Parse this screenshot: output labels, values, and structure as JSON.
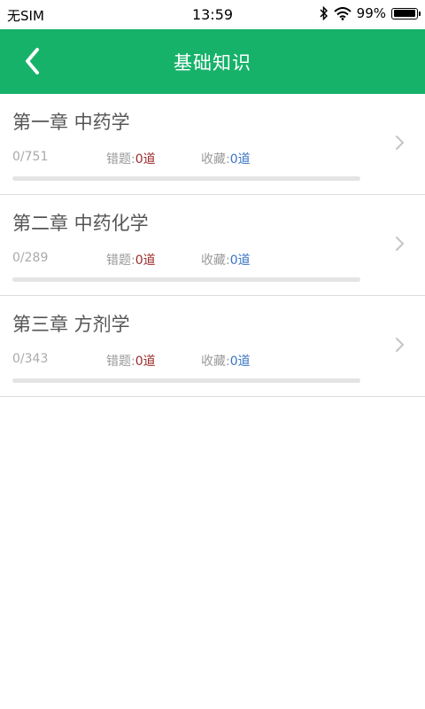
{
  "status": {
    "carrier": "无SIM",
    "time": "13:59",
    "battery": "99%",
    "battery_level": 0.99
  },
  "header": {
    "title": "基础知识"
  },
  "chapters": [
    {
      "title": "第一章 中药学",
      "progress": "0/751",
      "wrong_label": "错题:",
      "wrong_value": "0道",
      "fav_label": "收藏:",
      "fav_value": "0道",
      "progress_fraction": 0
    },
    {
      "title": "第二章 中药化学",
      "progress": "0/289",
      "wrong_label": "错题:",
      "wrong_value": "0道",
      "fav_label": "收藏:",
      "fav_value": "0道",
      "progress_fraction": 0
    },
    {
      "title": "第三章 方剂学",
      "progress": "0/343",
      "wrong_label": "错题:",
      "wrong_value": "0道",
      "fav_label": "收藏:",
      "fav_value": "0道",
      "progress_fraction": 0
    }
  ],
  "colors": {
    "primary": "#17b26a",
    "wrong_value": "#9b2b2b",
    "fav_value": "#3a75c4"
  }
}
